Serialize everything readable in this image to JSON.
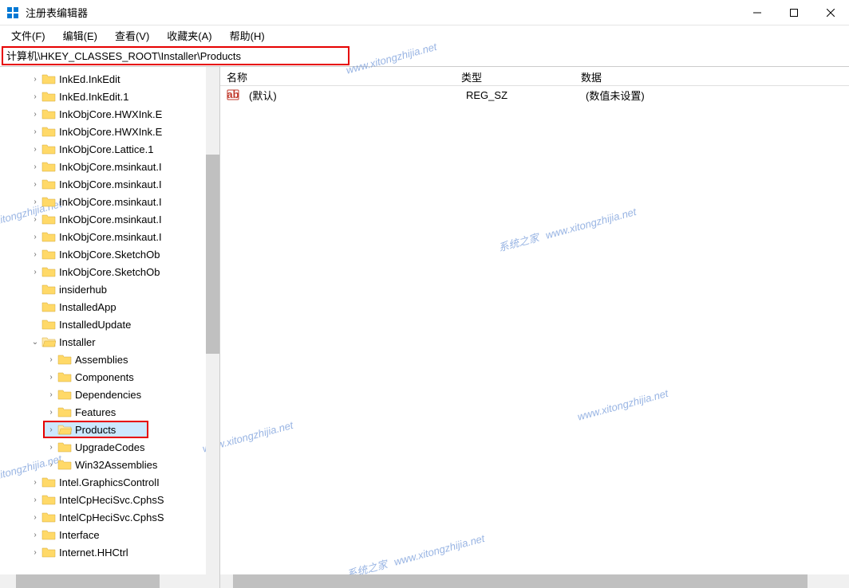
{
  "window": {
    "title": "注册表编辑器"
  },
  "menu": {
    "file": "文件(F)",
    "edit": "编辑(E)",
    "view": "查看(V)",
    "favorites": "收藏夹(A)",
    "help": "帮助(H)"
  },
  "address": "计算机\\HKEY_CLASSES_ROOT\\Installer\\Products",
  "tree": [
    {
      "label": "InkEd.InkEdit",
      "expand": ">",
      "level": 0
    },
    {
      "label": "InkEd.InkEdit.1",
      "expand": ">",
      "level": 0
    },
    {
      "label": "InkObjCore.HWXInk.E",
      "expand": ">",
      "level": 0
    },
    {
      "label": "InkObjCore.HWXInk.E",
      "expand": ">",
      "level": 0
    },
    {
      "label": "InkObjCore.Lattice.1",
      "expand": ">",
      "level": 0
    },
    {
      "label": "InkObjCore.msinkaut.I",
      "expand": ">",
      "level": 0
    },
    {
      "label": "InkObjCore.msinkaut.I",
      "expand": ">",
      "level": 0
    },
    {
      "label": "InkObjCore.msinkaut.I",
      "expand": ">",
      "level": 0
    },
    {
      "label": "InkObjCore.msinkaut.I",
      "expand": ">",
      "level": 0
    },
    {
      "label": "InkObjCore.msinkaut.I",
      "expand": ">",
      "level": 0
    },
    {
      "label": "InkObjCore.SketchOb",
      "expand": ">",
      "level": 0
    },
    {
      "label": "InkObjCore.SketchOb",
      "expand": ">",
      "level": 0
    },
    {
      "label": "insiderhub",
      "expand": "",
      "level": 0
    },
    {
      "label": "InstalledApp",
      "expand": "",
      "level": 0
    },
    {
      "label": "InstalledUpdate",
      "expand": "",
      "level": 0
    },
    {
      "label": "Installer",
      "expand": "v",
      "level": 0
    },
    {
      "label": "Assemblies",
      "expand": ">",
      "level": 1
    },
    {
      "label": "Components",
      "expand": ">",
      "level": 1
    },
    {
      "label": "Dependencies",
      "expand": ">",
      "level": 1
    },
    {
      "label": "Features",
      "expand": ">",
      "level": 1
    },
    {
      "label": "Products",
      "expand": ">",
      "level": 1,
      "selected": true,
      "highlighted": true
    },
    {
      "label": "UpgradeCodes",
      "expand": ">",
      "level": 1
    },
    {
      "label": "Win32Assemblies",
      "expand": ">",
      "level": 1
    },
    {
      "label": "Intel.GraphicsControlI",
      "expand": ">",
      "level": 0
    },
    {
      "label": "IntelCpHeciSvc.CphsS",
      "expand": ">",
      "level": 0
    },
    {
      "label": "IntelCpHeciSvc.CphsS",
      "expand": ">",
      "level": 0
    },
    {
      "label": "Interface",
      "expand": ">",
      "level": 0
    },
    {
      "label": "Internet.HHCtrl",
      "expand": ">",
      "level": 0
    }
  ],
  "columns": {
    "name": "名称",
    "type": "类型",
    "data": "数据"
  },
  "values": [
    {
      "name": "(默认)",
      "type": "REG_SZ",
      "data": "(数值未设置)"
    }
  ],
  "watermark": {
    "brand": "系统之家",
    "url": "www.xitongzhijia.net"
  }
}
